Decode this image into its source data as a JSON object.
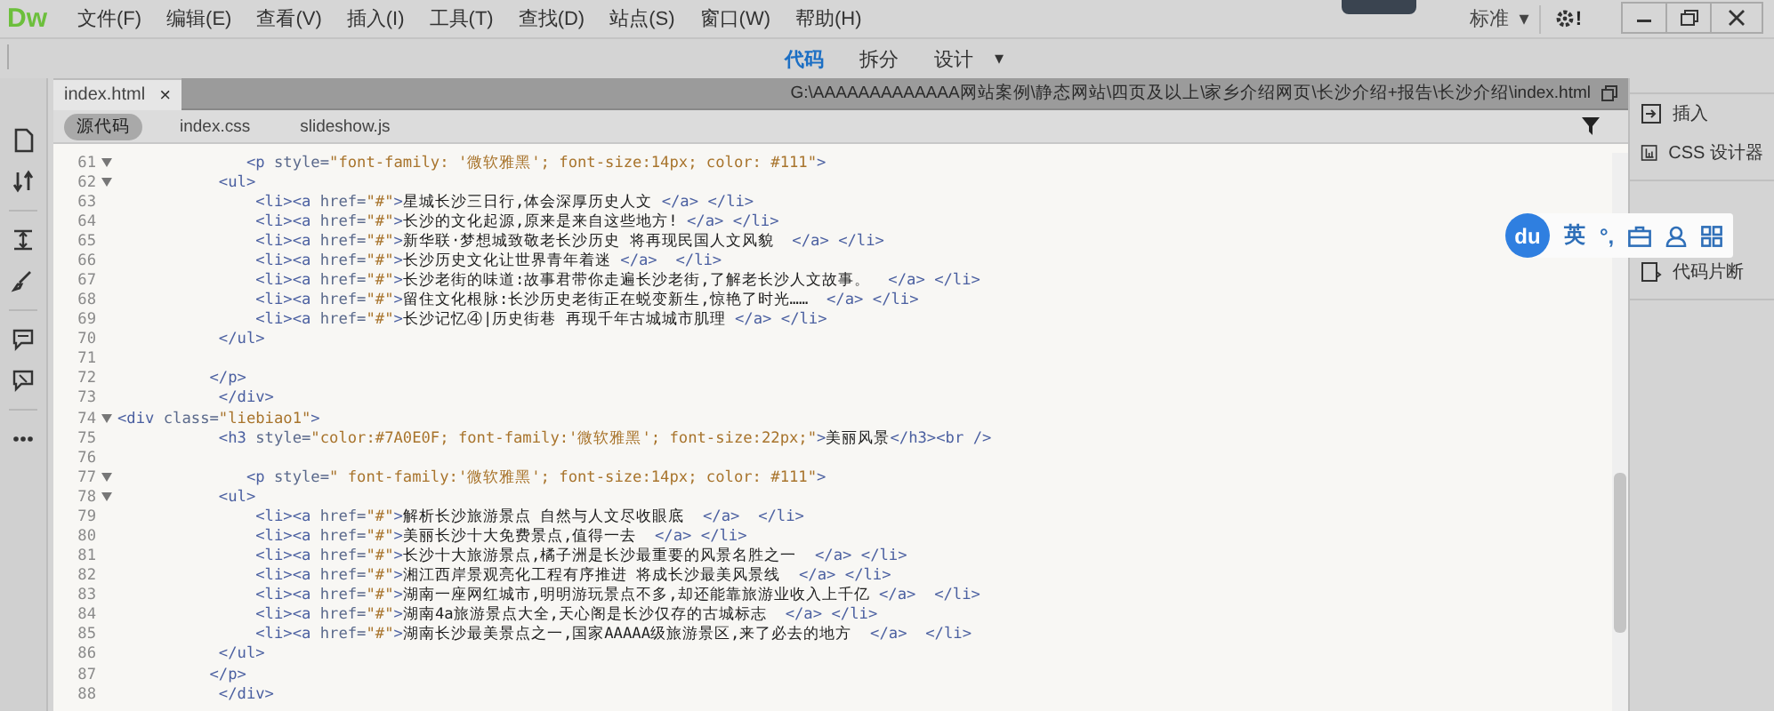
{
  "app": {
    "logo": "Dw",
    "menu": [
      "文件(F)",
      "编辑(E)",
      "查看(V)",
      "插入(I)",
      "工具(T)",
      "查找(D)",
      "站点(S)",
      "窗口(W)",
      "帮助(H)"
    ],
    "workspace": "标准",
    "workspace_caret": "▾",
    "settings_badge": "!"
  },
  "view_switcher": [
    {
      "label": "代码",
      "selected": true
    },
    {
      "label": "拆分",
      "selected": false
    },
    {
      "label": "设计",
      "selected": false
    }
  ],
  "view_caret": "▾",
  "document_tab": {
    "label": "index.html",
    "close": "×"
  },
  "file_path": "G:\\AAAAAAAAAAAAA网站案例\\静态网站\\四页及以上\\家乡介绍网页\\长沙介绍+报告\\长沙介绍\\index.html",
  "related_files": [
    {
      "label": "源代码",
      "selected": true
    },
    {
      "label": "index.css",
      "selected": false
    },
    {
      "label": "slideshow.js",
      "selected": false
    }
  ],
  "code_lines": [
    {
      "number": "61",
      "foldable": true,
      "code": "              <p style=\"font-family: '微软雅黑'; font-size:14px; color: #111\">"
    },
    {
      "number": "62",
      "foldable": true,
      "code": "           <ul>"
    },
    {
      "number": "63",
      "foldable": false,
      "code": "               <li><a href=\"#\">星城长沙三日行,体会深厚历史人文 </a> </li>"
    },
    {
      "number": "64",
      "foldable": false,
      "code": "               <li><a href=\"#\">长沙的文化起源,原来是来自这些地方! </a> </li>"
    },
    {
      "number": "65",
      "foldable": false,
      "code": "               <li><a href=\"#\">新华联·梦想城致敬老长沙历史 将再现民国人文风貌  </a> </li>"
    },
    {
      "number": "66",
      "foldable": false,
      "code": "               <li><a href=\"#\">长沙历史文化让世界青年着迷 </a>  </li>"
    },
    {
      "number": "67",
      "foldable": false,
      "code": "               <li><a href=\"#\">长沙老街的味道:故事君带你走遍长沙老街,了解老长沙人文故事。  </a> </li>"
    },
    {
      "number": "68",
      "foldable": false,
      "code": "               <li><a href=\"#\">留住文化根脉:长沙历史老街正在蜕变新生,惊艳了时光……  </a> </li>"
    },
    {
      "number": "69",
      "foldable": false,
      "code": "               <li><a href=\"#\">长沙记忆④|历史街巷 再现千年古城城市肌理 </a> </li>"
    },
    {
      "number": "70",
      "foldable": false,
      "code": "           </ul>"
    },
    {
      "number": "71",
      "foldable": false
    },
    {
      "number": "72",
      "foldable": false,
      "code": "          </p>"
    },
    {
      "number": "73",
      "foldable": false,
      "code": "           </div>"
    },
    {
      "number": "74",
      "foldable": true,
      "code": "<div class=\"liebiao1\">"
    },
    {
      "number": "75",
      "foldable": false,
      "code": "           <h3 style=\"color:#7A0E0F; font-family:'微软雅黑'; font-size:22px;\">美丽风景</h3><br />"
    },
    {
      "number": "76",
      "foldable": false
    },
    {
      "number": "77",
      "foldable": true,
      "code": "              <p style=\" font-family:'微软雅黑'; font-size:14px; color: #111\">"
    },
    {
      "number": "78",
      "foldable": true,
      "code": "           <ul>"
    },
    {
      "number": "79",
      "foldable": false,
      "code": "               <li><a href=\"#\">解析长沙旅游景点 自然与人文尽收眼底  </a>  </li>"
    },
    {
      "number": "80",
      "foldable": false,
      "code": "               <li><a href=\"#\">美丽长沙十大免费景点,值得一去  </a> </li>"
    },
    {
      "number": "81",
      "foldable": false,
      "code": "               <li><a href=\"#\">长沙十大旅游景点,橘子洲是长沙最重要的风景名胜之一  </a> </li>"
    },
    {
      "number": "82",
      "foldable": false,
      "code": "               <li><a href=\"#\">湘江西岸景观亮化工程有序推进 将成长沙最美风景线  </a> </li>"
    },
    {
      "number": "83",
      "foldable": false,
      "code": "               <li><a href=\"#\">湖南一座网红城市,明明游玩景点不多,却还能靠旅游业收入上千亿 </a>  </li>"
    },
    {
      "number": "84",
      "foldable": false,
      "code": "               <li><a href=\"#\">湖南4a旅游景点大全,天心阁是长沙仅存的古城标志  </a> </li>"
    },
    {
      "number": "85",
      "foldable": false,
      "code": "               <li><a href=\"#\">湖南长沙最美景点之一,国家AAAAA级旅游景区,来了必去的地方  </a>  </li>"
    },
    {
      "number": "86",
      "foldable": false,
      "code": "           </ul>"
    },
    {
      "number": "87",
      "foldable": false,
      "code": "          </p>"
    },
    {
      "number": "88",
      "foldable": false,
      "code": "           </div>"
    }
  ],
  "panels": [
    {
      "label": "插入",
      "kind": "insert"
    },
    {
      "label": "CSS 设计器",
      "kind": "css"
    },
    {
      "label": "代码片断",
      "kind": "snippets"
    }
  ],
  "ime_toolbar": {
    "logo": "du",
    "mode": "英",
    "punctuation": "°,"
  }
}
